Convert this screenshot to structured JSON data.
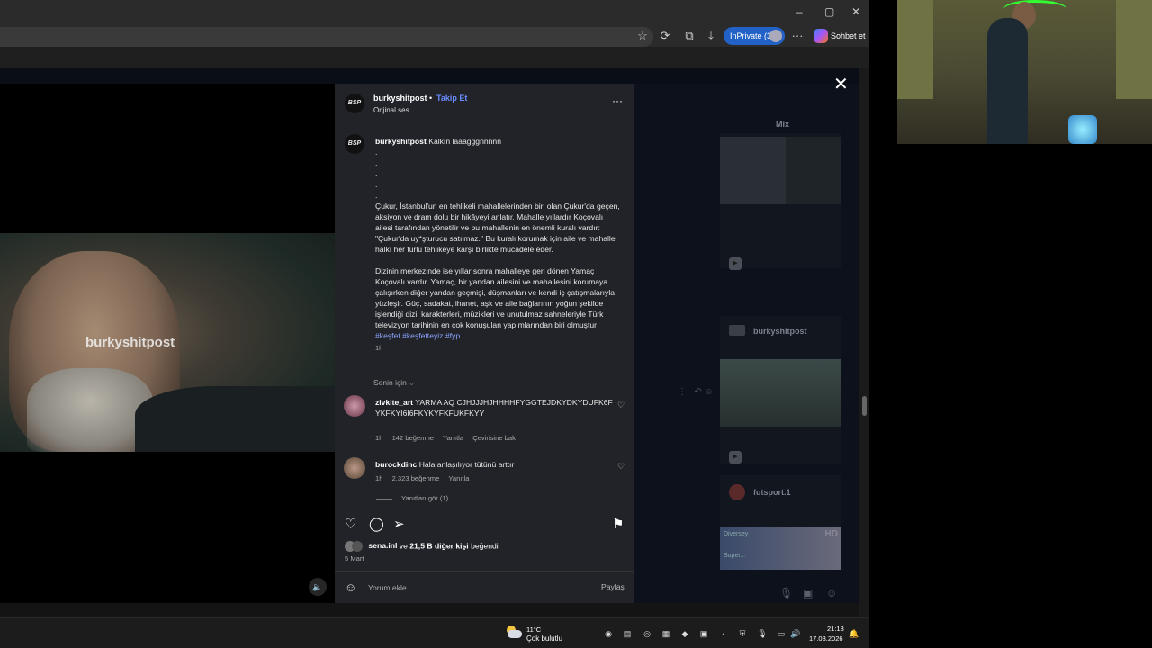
{
  "browser": {
    "inprivate_label": "InPrivate (3)",
    "copilot_label": "Sohbet et",
    "window_controls": [
      "–",
      "▢",
      "✕"
    ]
  },
  "video": {
    "watermark": "burkyshitpost",
    "mute_icon": "speaker-icon"
  },
  "post": {
    "avatar_text": "BSP",
    "username": "burkyshitpost",
    "separator": "•",
    "follow_label": "Takip Et",
    "audio": "Orijinal ses",
    "more": "···",
    "caption": {
      "username": "burkyshitpost",
      "first_line": "Kalkın laaağğğnnnnn",
      "dots": ".\n.\n.\n.\n.",
      "para1": "Çukur, İstanbul'un en tehlikeli mahallelerinden biri olan Çukur'da geçen, aksiyon ve dram dolu bir hikâyeyi anlatır. Mahalle yıllardır Koçovalı ailesi tarafından yönetilir ve bu mahallenin en önemli kuralı vardır: \"Çukur'da uy*şturucu satılmaz.\" Bu kuralı korumak için aile ve mahalle halkı her türlü tehlikeye karşı birlikte mücadele eder.",
      "para2": "Dizinin merkezinde ise yıllar sonra mahalleye geri dönen Yamaç Koçovalı vardır. Yamaç, bir yandan ailesini ve mahallesini korumaya çalışırken diğer yandan geçmişi, düşmanları ve kendi iç çatışmalarıyla yüzleşir. Güç, sadakat, ihanet, aşk ve aile bağlarının yoğun şekilde işlendiği dizi; karakterleri, müzikleri ve unutulmaz sahneleriyle Türk televizyon tarihinin en çok konuşulan yapımlarından biri olmuştur",
      "hashtags": "#keşfet #keşfetteyiz #fyp",
      "time": "1h"
    },
    "comments_filter": "Senin için ⌵",
    "comments": [
      {
        "username": "zivkite_art",
        "text": "YARMA AQ CJHJJJHJHHHHFYGGTEJDKYDKYDUFK6FYKFKYI6I6FKYKYFKFUKFKYY",
        "time": "1h",
        "likes": "142 beğenme",
        "reply": "Yanıtla",
        "translate": "Çevirisine bak"
      },
      {
        "username": "burockdinc",
        "text": "Hala anlaşılıyor tütünü arttır",
        "time": "1h",
        "likes": "2.323 beğenme",
        "reply": "Yanıtla"
      }
    ],
    "view_replies": "Yanıtları gör (1)",
    "liked_by_user": "sena.inl",
    "liked_by_rest": "ve",
    "liked_by_count": "21,5 B diğer kişi",
    "liked_by_suffix": "beğendi",
    "date": "5 Mart",
    "comment_placeholder": "Yorum ekle...",
    "share_label": "Paylaş"
  },
  "background": {
    "label_top": "Mix",
    "card1_user": "burkyshitpost",
    "card2_user": "futsport.1",
    "hd_badge": "HD",
    "thumb_text_1": "Diversey",
    "thumb_text_2": "Super..."
  },
  "taskbar": {
    "weather_temp": "11°C",
    "weather_desc": "Çok bulutlu",
    "clock_time": "21:13",
    "clock_date": "17.03.2026"
  },
  "colors": {
    "accent_blue": "#6b8cff",
    "inprivate_blue": "#2261c6",
    "panel_bg": "#212328"
  }
}
